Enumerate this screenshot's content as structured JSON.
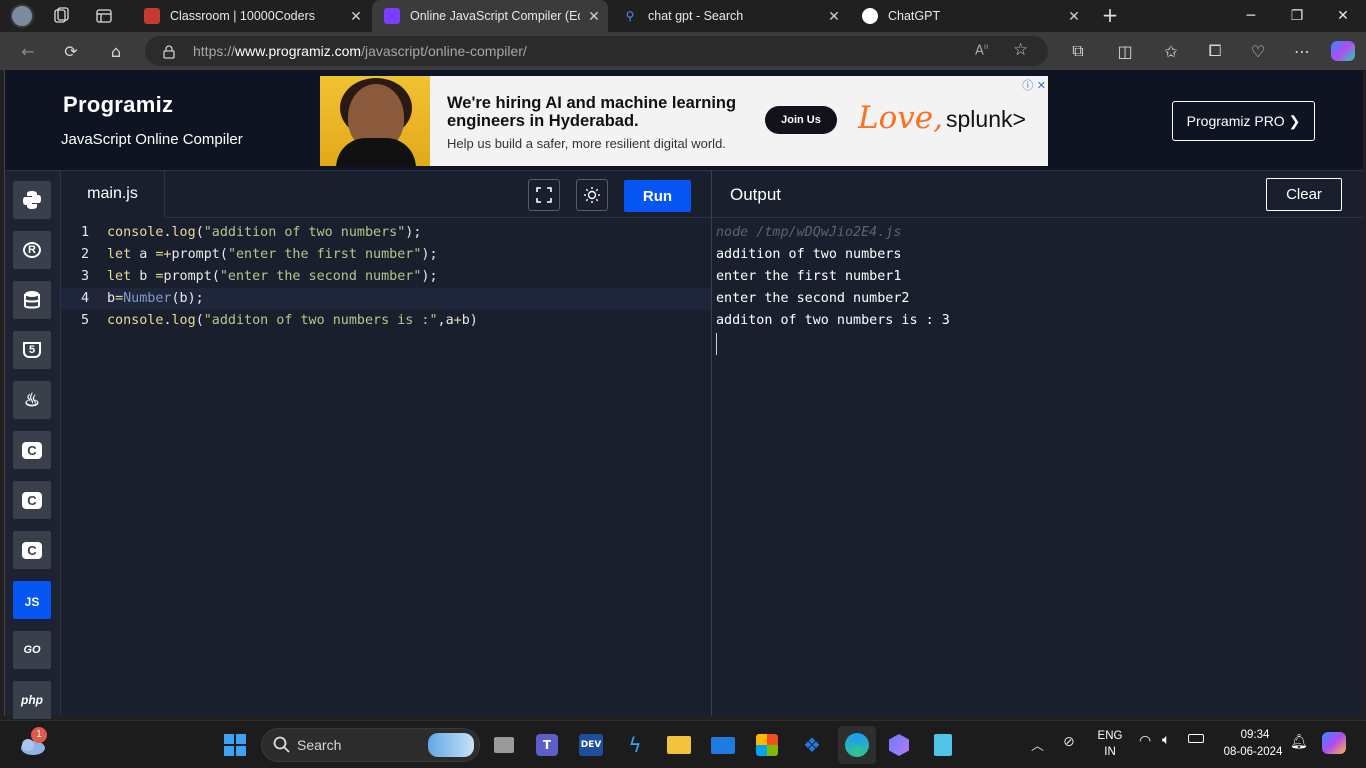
{
  "browser": {
    "tabs": [
      {
        "title": "Classroom | 10000Coders",
        "active": false,
        "favicon_color": "#c8392f"
      },
      {
        "title": "Online JavaScript Compiler (Edito",
        "active": true,
        "favicon_color": "#7a3cff"
      },
      {
        "title": "chat gpt - Search",
        "active": false,
        "favicon_color": "#4a8ff0"
      },
      {
        "title": "ChatGPT",
        "active": false,
        "favicon_color": "#ffffff"
      }
    ],
    "url_prefix": "https://",
    "url_host": "www.programiz.com",
    "url_path": "/javascript/online-compiler/"
  },
  "site": {
    "logo": "Programiz",
    "subtitle": "JavaScript Online Compiler",
    "pro_button": "Programiz PRO ❯"
  },
  "ad": {
    "headline": "We're hiring AI and machine learning engineers in Hyderabad.",
    "subtext": "Help us build a safer, more resilient digital world.",
    "cta": "Join Us",
    "brand_love": "Love,",
    "brand_name": "splunk>"
  },
  "languages": [
    {
      "name": "python-icon",
      "label": ""
    },
    {
      "name": "r-icon",
      "label": "R"
    },
    {
      "name": "sql-icon",
      "label": ""
    },
    {
      "name": "html5-icon",
      "label": "5"
    },
    {
      "name": "java-icon",
      "label": ""
    },
    {
      "name": "c-icon",
      "label": "C"
    },
    {
      "name": "cplusplus-icon",
      "label": "C"
    },
    {
      "name": "csharp-icon",
      "label": "C"
    },
    {
      "name": "javascript-icon",
      "label": "JS",
      "active": true
    },
    {
      "name": "go-icon",
      "label": "GO"
    },
    {
      "name": "php-icon",
      "label": "php"
    }
  ],
  "editor": {
    "filename": "main.js",
    "run_label": "Run",
    "current_line": 4,
    "lines": [
      [
        {
          "t": "console",
          "c": "k"
        },
        {
          "t": ".",
          "c": "p"
        },
        {
          "t": "log",
          "c": "k"
        },
        {
          "t": "(",
          "c": "p"
        },
        {
          "t": "\"addition of two numbers\"",
          "c": "s"
        },
        {
          "t": ");",
          "c": "p"
        }
      ],
      [
        {
          "t": "let",
          "c": "k"
        },
        {
          "t": " a ",
          "c": "p"
        },
        {
          "t": "=+",
          "c": "k"
        },
        {
          "t": "prompt",
          "c": "p"
        },
        {
          "t": "(",
          "c": "p"
        },
        {
          "t": "\"enter the first number\"",
          "c": "s"
        },
        {
          "t": ");",
          "c": "p"
        }
      ],
      [
        {
          "t": "let",
          "c": "k"
        },
        {
          "t": " b ",
          "c": "p"
        },
        {
          "t": "=",
          "c": "k"
        },
        {
          "t": "prompt",
          "c": "p"
        },
        {
          "t": "(",
          "c": "p"
        },
        {
          "t": "\"enter the second number\"",
          "c": "s"
        },
        {
          "t": ");",
          "c": "p"
        }
      ],
      [
        {
          "t": "b",
          "c": "p"
        },
        {
          "t": "=",
          "c": "k"
        },
        {
          "t": "Number",
          "c": "n"
        },
        {
          "t": "(b);",
          "c": "p"
        }
      ],
      [
        {
          "t": "console",
          "c": "k"
        },
        {
          "t": ".",
          "c": "p"
        },
        {
          "t": "log",
          "c": "k"
        },
        {
          "t": "(",
          "c": "p"
        },
        {
          "t": "\"additon of two numbers is :\"",
          "c": "s"
        },
        {
          "t": ",a",
          "c": "p"
        },
        {
          "t": "+",
          "c": "k"
        },
        {
          "t": "b)",
          "c": "p"
        }
      ]
    ]
  },
  "output": {
    "title": "Output",
    "clear_label": "Clear",
    "command": "node /tmp/wDQwJio2E4.js",
    "lines": [
      "addition of two numbers",
      "enter the first number1",
      "enter the second number2",
      "additon of two numbers is : 3"
    ]
  },
  "taskbar": {
    "search_placeholder": "Search",
    "weather_badge": "1",
    "language_top": "ENG",
    "language_bottom": "IN",
    "time": "09:34",
    "date": "08-06-2024"
  },
  "colors": {
    "accent": "#0556f3",
    "editor_bg": "#1a1f2e",
    "header_bg": "#0f1423"
  }
}
